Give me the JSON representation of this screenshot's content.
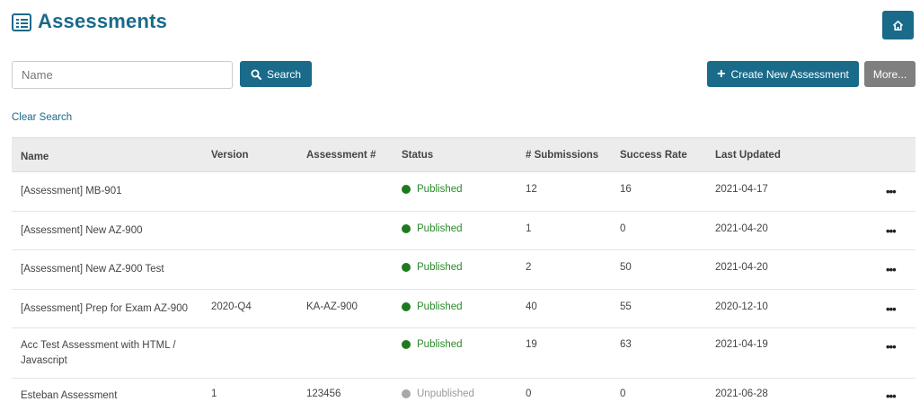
{
  "header": {
    "title": "Assessments",
    "title_icon": "list-icon",
    "home_icon": "home-icon"
  },
  "search": {
    "placeholder": "Name",
    "value": "",
    "button_label": "Search",
    "button_icon": "search-icon",
    "clear_label": "Clear Search"
  },
  "actions": {
    "create_label": "Create New Assessment",
    "create_icon": "plus-icon",
    "more_label": "More..."
  },
  "colors": {
    "primary": "#1a6a8a",
    "published": "#1f7a1f",
    "unpublished": "#a8a8a8",
    "more_button": "#7f7f7f"
  },
  "table": {
    "columns": [
      "Name",
      "Version",
      "Assessment #",
      "Status",
      "# Submissions",
      "Success Rate",
      "Last Updated"
    ],
    "rows": [
      {
        "name": "[Assessment] MB-901",
        "version": "",
        "assessment_no": "",
        "status": "Published",
        "submissions": "12",
        "success_rate": "16",
        "last_updated": "2021-04-17",
        "actions": "•••"
      },
      {
        "name": "[Assessment] New AZ-900",
        "version": "",
        "assessment_no": "",
        "status": "Published",
        "submissions": "1",
        "success_rate": "0",
        "last_updated": "2021-04-20",
        "actions": "•••"
      },
      {
        "name": "[Assessment] New AZ-900 Test",
        "version": "",
        "assessment_no": "",
        "status": "Published",
        "submissions": "2",
        "success_rate": "50",
        "last_updated": "2021-04-20",
        "actions": "•••"
      },
      {
        "name": "[Assessment] Prep for Exam AZ-900",
        "version": "2020-Q4",
        "assessment_no": "KA-AZ-900",
        "status": "Published",
        "submissions": "40",
        "success_rate": "55",
        "last_updated": "2020-12-10",
        "actions": "•••"
      },
      {
        "name": "Acc Test Assessment with HTML / Javascript",
        "version": "",
        "assessment_no": "",
        "status": "Published",
        "submissions": "19",
        "success_rate": "63",
        "last_updated": "2021-04-19",
        "actions": "•••"
      },
      {
        "name": "Esteban Assessment",
        "version": "1",
        "assessment_no": "123456",
        "status": "Unpublished",
        "submissions": "0",
        "success_rate": "0",
        "last_updated": "2021-06-28",
        "actions": "•••"
      }
    ]
  }
}
